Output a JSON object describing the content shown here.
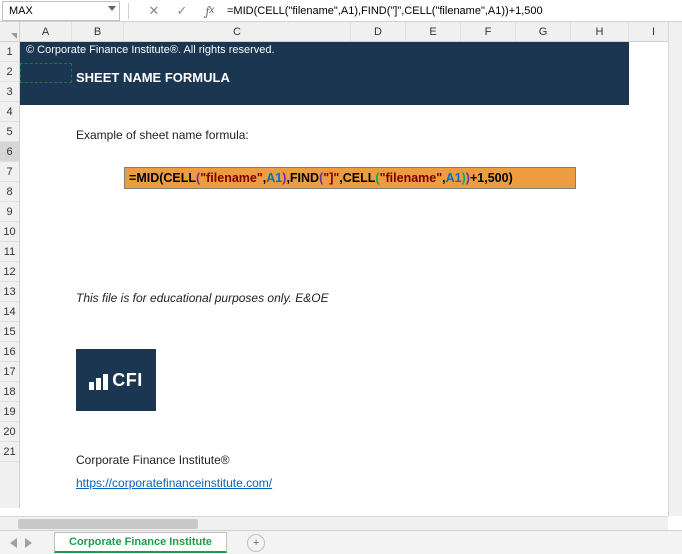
{
  "namebox": {
    "value": "MAX"
  },
  "formula_bar": {
    "text": "=MID(CELL(\"filename\",A1),FIND(\"]\",CELL(\"filename\",A1))+1,500"
  },
  "columns": [
    "A",
    "B",
    "C",
    "D",
    "E",
    "F",
    "G",
    "H",
    "I"
  ],
  "rows": [
    "1",
    "2",
    "3",
    "4",
    "5",
    "6",
    "7",
    "8",
    "9",
    "10",
    "11",
    "12",
    "13",
    "14",
    "15",
    "16",
    "17",
    "18",
    "19",
    "20",
    "21"
  ],
  "banner": {
    "line1": "© Corporate Finance Institute®. All rights reserved.",
    "line2": "SHEET NAME FORMULA"
  },
  "content": {
    "example_label": "Example of sheet name formula:",
    "formula_parts": {
      "eq": "=",
      "mid": "MID",
      "op1": "(",
      "cell1": "CELL",
      "op2": "(",
      "str1": "\"filename\"",
      "c1": ",",
      "ref1": "A1",
      "cp2": ")",
      "c2": ",",
      "find": "FIND",
      "op3": "(",
      "str2": "\"]\"",
      "c3": ",",
      "cell2": "CELL",
      "op4": "(",
      "str3": "\"filename\"",
      "c4": ",",
      "ref2": "A1",
      "cp4": ")",
      "cp3": ")",
      "plus1": "+1,500",
      "cp1": ")"
    },
    "disclaimer": "This file is for educational purposes only. E&OE",
    "logo_text": "CFI",
    "company": "Corporate Finance Institute®",
    "url": "https://corporatefinanceinstitute.com/"
  },
  "tabs": {
    "active": "Corporate Finance Institute",
    "add": "+"
  }
}
